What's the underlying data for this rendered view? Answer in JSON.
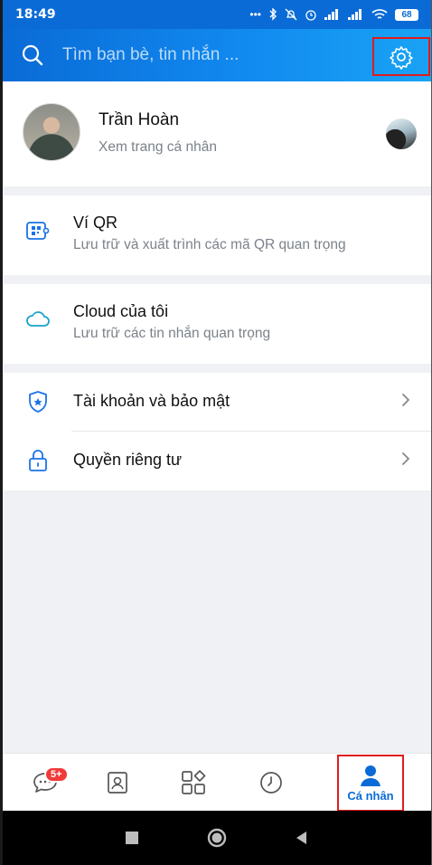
{
  "status_bar": {
    "time": "18:49",
    "battery": "68"
  },
  "header": {
    "search_placeholder": "Tìm bạn bè, tin nhắn ...",
    "search_icon": "search-icon",
    "settings_icon": "gear-icon"
  },
  "profile": {
    "name": "Trần Hoàn",
    "subtitle": "Xem trang cá nhân"
  },
  "menu": {
    "qr_wallet": {
      "title": "Ví QR",
      "desc": "Lưu trữ và xuất trình các mã QR quan trọng",
      "icon": "qr-wallet-icon"
    },
    "cloud": {
      "title": "Cloud của tôi",
      "desc": "Lưu trữ các tin nhắn quan trọng",
      "icon": "cloud-icon"
    },
    "account_security": {
      "title": "Tài khoản và bảo mật",
      "icon": "shield-icon"
    },
    "privacy": {
      "title": "Quyền riêng tư",
      "icon": "lock-icon"
    }
  },
  "bottom_nav": {
    "messages_badge": "5+",
    "active_label": "Cá nhân",
    "icons": [
      "chat-icon",
      "contacts-icon",
      "apps-icon",
      "clock-icon",
      "person-icon"
    ]
  },
  "colors": {
    "brand_blue": "#0a6bd6",
    "highlight_red": "#e01c1c",
    "badge_red": "#ef3a3a"
  }
}
